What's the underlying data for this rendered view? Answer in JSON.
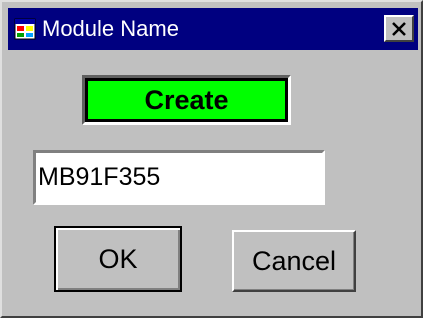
{
  "window": {
    "title": "Module Name",
    "icon": "app-icon",
    "close_icon": "close-icon"
  },
  "status": {
    "label": "Create",
    "color": "#00ff00"
  },
  "module_field": {
    "value": "MB91F355"
  },
  "buttons": {
    "ok_label": "OK",
    "cancel_label": "Cancel"
  },
  "colors": {
    "titlebar": "#000080",
    "dialog_bg": "#c0c0c0"
  }
}
